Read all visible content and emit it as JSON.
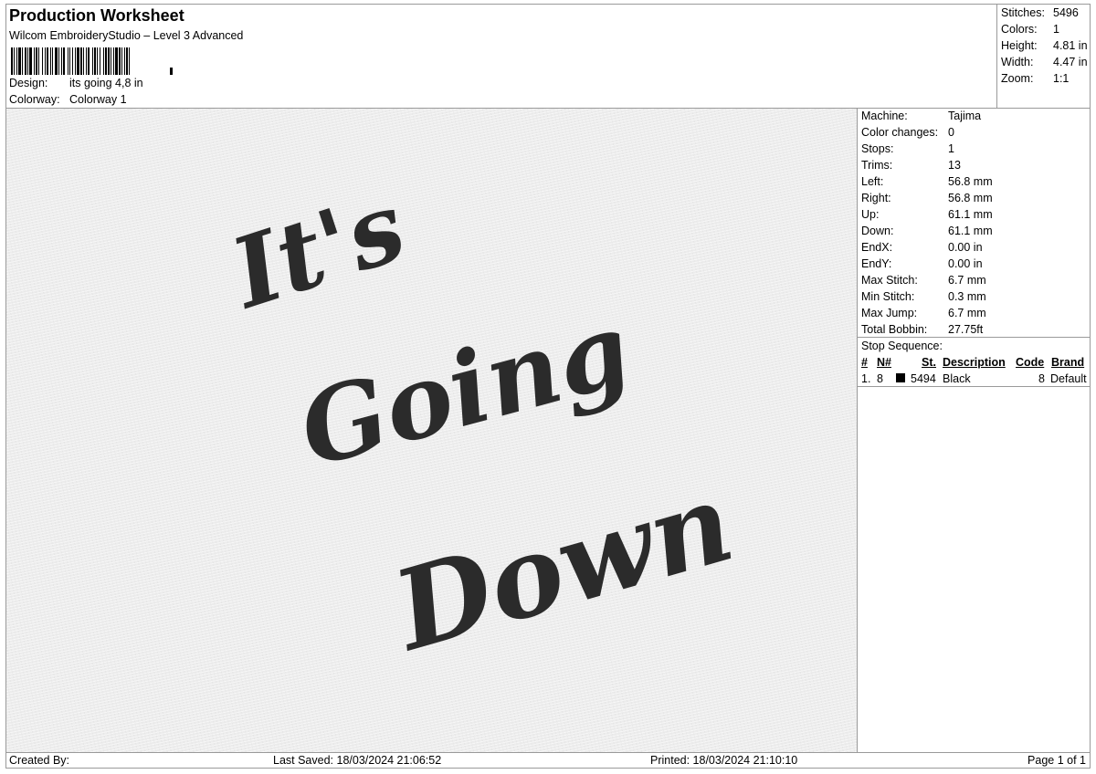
{
  "header": {
    "title": "Production Worksheet",
    "software": "Wilcom EmbroideryStudio – Level 3 Advanced",
    "design_label": "Design:",
    "design_value": "its going 4,8 in",
    "colorway_label": "Colorway:",
    "colorway_value": "Colorway 1"
  },
  "stats": [
    {
      "label": "Stitches:",
      "value": "5496"
    },
    {
      "label": "Colors:",
      "value": "1"
    },
    {
      "label": "Height:",
      "value": "4.81 in"
    },
    {
      "label": "Width:",
      "value": "4.47 in"
    },
    {
      "label": "Zoom:",
      "value": "1:1"
    }
  ],
  "machine_info": [
    {
      "label": "Machine:",
      "value": "Tajima"
    },
    {
      "label": "Color changes:",
      "value": "0"
    },
    {
      "label": "Stops:",
      "value": "1"
    },
    {
      "label": "Trims:",
      "value": "13"
    },
    {
      "label": "Left:",
      "value": "56.8 mm"
    },
    {
      "label": "Right:",
      "value": "56.8 mm"
    },
    {
      "label": "Up:",
      "value": "61.1 mm"
    },
    {
      "label": "Down:",
      "value": "61.1 mm"
    },
    {
      "label": "EndX:",
      "value": "0.00 in"
    },
    {
      "label": "EndY:",
      "value": "0.00 in"
    },
    {
      "label": "Max Stitch:",
      "value": "6.7 mm"
    },
    {
      "label": "Min Stitch:",
      "value": "0.3 mm"
    },
    {
      "label": "Max Jump:",
      "value": "6.7 mm"
    },
    {
      "label": "Total Bobbin:",
      "value": "27.75ft"
    }
  ],
  "stop_sequence": {
    "title": "Stop Sequence:",
    "headers": {
      "num": "#",
      "n": "N#",
      "st": "St.",
      "desc": "Description",
      "code": "Code",
      "brand": "Brand"
    },
    "rows": [
      {
        "num": "1.",
        "n": "8",
        "swatch_color": "#000000",
        "st": "5494",
        "desc": "Black",
        "code": "8",
        "brand": "Default"
      }
    ]
  },
  "design_preview": {
    "lines": [
      "It's",
      "Going",
      "Down"
    ],
    "thread_color": "#2b2b2b"
  },
  "footer": {
    "created_by": "Created By:",
    "last_saved": "Last Saved: 18/03/2024 21:06:52",
    "printed": "Printed: 18/03/2024 21:10:10",
    "page": "Page 1 of 1"
  }
}
